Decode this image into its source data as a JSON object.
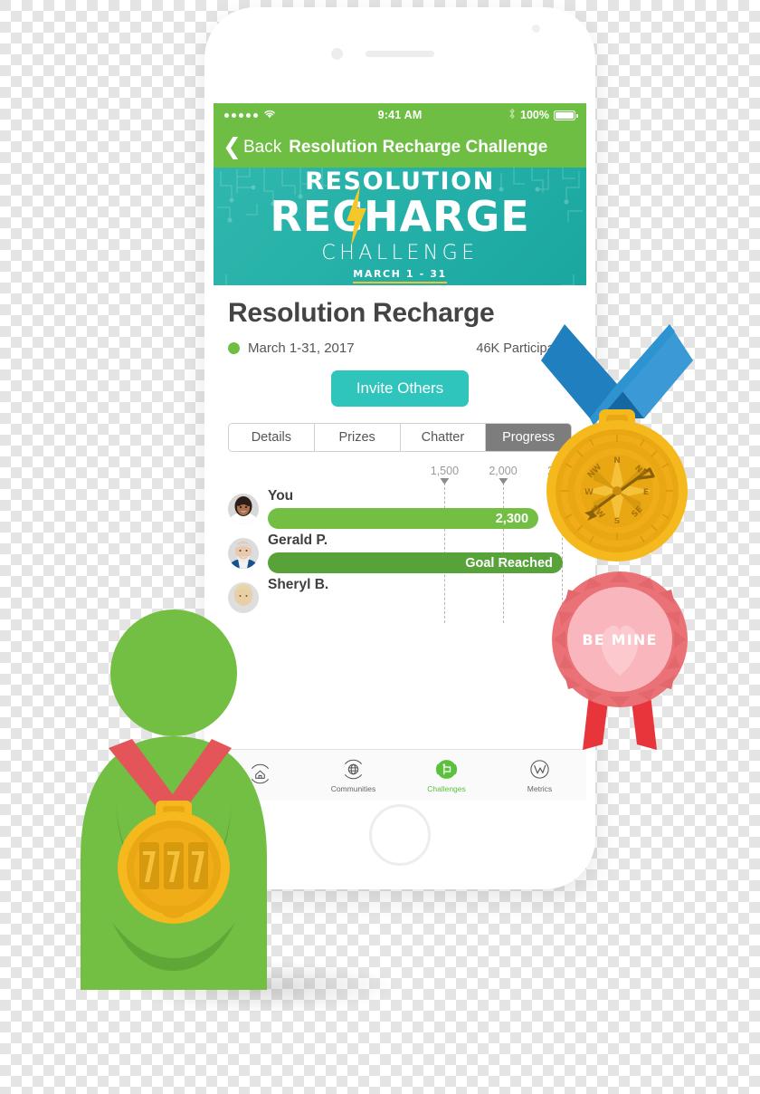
{
  "statusbar": {
    "time": "9:41 AM",
    "battery_percent": "100%",
    "signal_icon": "signal-dots-icon",
    "wifi_icon": "wifi-icon",
    "bluetooth_icon": "bluetooth-icon",
    "battery_icon": "battery-full-icon"
  },
  "navbar": {
    "back_label": "Back",
    "back_icon": "chevron-left-icon",
    "title": "Resolution Recharge Challenge"
  },
  "banner": {
    "line1": "RESOLUTION",
    "line2": "RECHARGE",
    "line3": "CHALLENGE",
    "line4": "MARCH 1 - 31",
    "bolt_icon": "lightning-bolt-icon",
    "bg_color": "#24b0a8",
    "accent_color": "#f2c230"
  },
  "detail": {
    "title": "Resolution Recharge",
    "status_dot_color": "#6fbe44",
    "date_range": "March 1-31, 2017",
    "participants": "46K Participants",
    "invite_label": "Invite Others",
    "invite_color": "#2fc5bd"
  },
  "tabs": [
    {
      "label": "Details",
      "active": false
    },
    {
      "label": "Prizes",
      "active": false
    },
    {
      "label": "Chatter",
      "active": false
    },
    {
      "label": "Progress",
      "active": true
    }
  ],
  "chart_data": {
    "type": "bar",
    "title": "Progress",
    "orientation": "horizontal",
    "xlabel": "",
    "ylabel": "",
    "grid": true,
    "axis_ticks": [
      {
        "label": "1,500",
        "value": 1500,
        "pos_pct": 63
      },
      {
        "label": "2,000",
        "value": 2000,
        "pos_pct": 80
      },
      {
        "label": "2,500",
        "value": 2500,
        "pos_pct": 97
      }
    ],
    "xlim": [
      0,
      2580
    ],
    "categories": [
      "You",
      "Gerald P.",
      "Sheryl B."
    ],
    "series": [
      {
        "name": "Points",
        "values": [
          2300,
          2500,
          null
        ],
        "labels": [
          "2,300",
          "Goal Reached",
          ""
        ]
      }
    ],
    "rows": [
      {
        "name": "You",
        "avatar": "avatar-woman-smiling",
        "value": 2300,
        "bar_label": "2,300",
        "bar_pct": 89,
        "bar_color": "#72bf44"
      },
      {
        "name": "Gerald P.",
        "avatar": "avatar-older-man",
        "value": 2500,
        "bar_label": "Goal Reached",
        "bar_pct": 97,
        "bar_color": "#58a23a"
      },
      {
        "name": "Sheryl B.",
        "avatar": "avatar-blonde-woman",
        "value": null,
        "bar_label": "",
        "bar_pct": 0,
        "bar_color": "#72bf44"
      }
    ]
  },
  "tabbar": [
    {
      "label": "",
      "icon": "home-icon",
      "active": false
    },
    {
      "label": "Communities",
      "icon": "globe-icon",
      "active": false
    },
    {
      "label": "Challenges",
      "icon": "challenge-flag-icon",
      "active": true
    },
    {
      "label": "Metrics",
      "icon": "metrics-chart-icon",
      "active": false
    }
  ],
  "decorations": {
    "gold_medal": {
      "name": "gold-compass-medal",
      "ribbon_color": "#1f7fbf",
      "medal_color": "#f5b91d",
      "compass_labels": [
        "N",
        "NE",
        "E",
        "SE",
        "S",
        "SW",
        "W",
        "NW"
      ]
    },
    "rosette": {
      "name": "be-mine-rosette",
      "text": "BE MINE",
      "rosette_color": "#f0868a",
      "center_color": "#f9b7bd",
      "heart_color": "#fbc9ce",
      "tail_color": "#e8353c"
    },
    "green_person_medal": {
      "name": "green-person-with-777-medal",
      "body_color": "#72bf44",
      "ribbon_color": "#e4555a",
      "medal_color": "#f5b91d",
      "medal_text": "777"
    }
  }
}
